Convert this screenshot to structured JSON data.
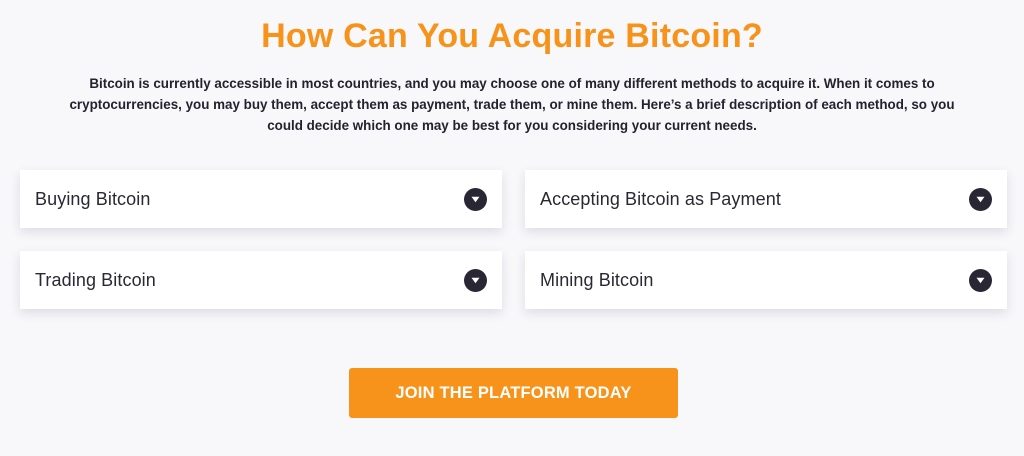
{
  "section": {
    "title": "How Can You Acquire Bitcoin?",
    "intro": "Bitcoin is currently accessible in most countries, and you may choose one of many different methods to acquire it. When it comes to cryptocurrencies, you may buy them, accept them as payment, trade them, or mine them. Here’s a brief description of each method, so you could decide which one may be best for you considering your current needs."
  },
  "accordions": [
    {
      "label": "Buying Bitcoin",
      "icon": "chevron-down-icon",
      "expanded": false
    },
    {
      "label": "Accepting Bitcoin as Payment",
      "icon": "chevron-down-icon",
      "expanded": false
    },
    {
      "label": "Trading Bitcoin",
      "icon": "chevron-down-icon",
      "expanded": false
    },
    {
      "label": "Mining Bitcoin",
      "icon": "chevron-down-icon",
      "expanded": false
    }
  ],
  "cta": {
    "label": "JOIN THE PLATFORM TODAY"
  },
  "colors": {
    "accent": "#f7931a",
    "toggle_bg": "#2a2735",
    "text": "#24222c",
    "background": "#f8f8fb",
    "card": "#ffffff"
  }
}
